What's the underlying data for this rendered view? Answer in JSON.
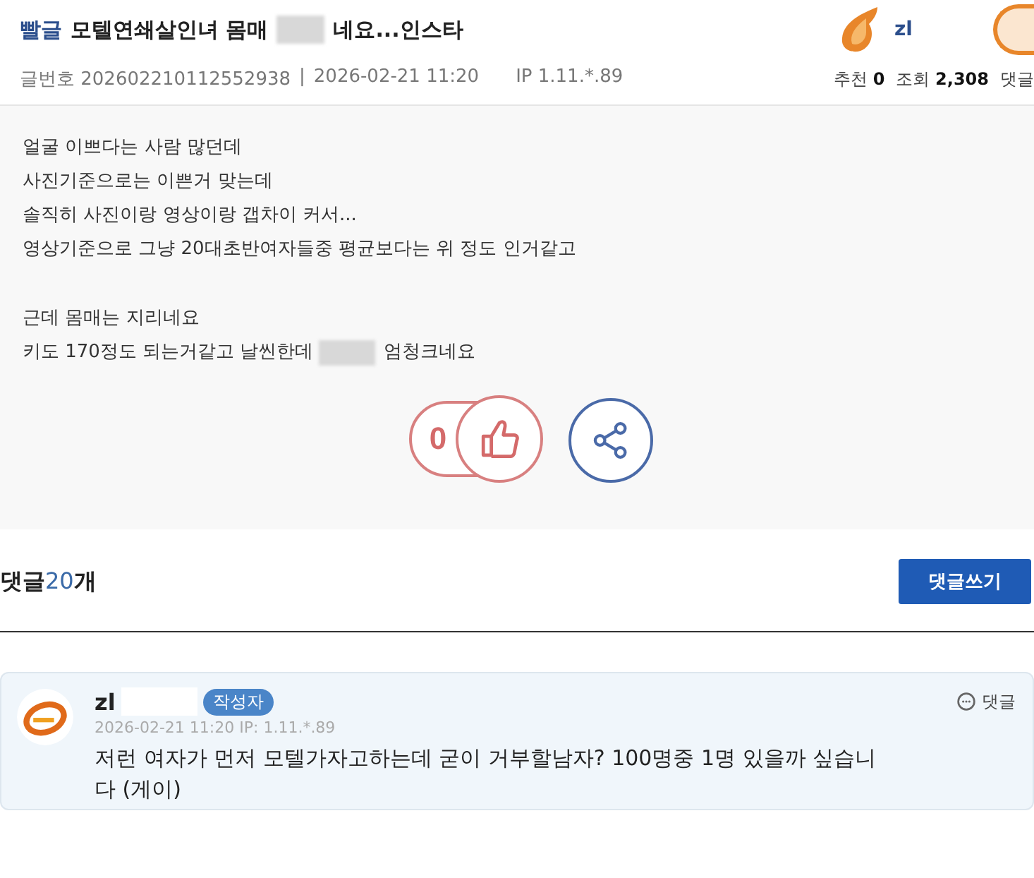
{
  "post": {
    "category": "빨글",
    "title_before": "모텔연쇄살인녀 몸매",
    "title_after": "네요...인스타",
    "author": "zl",
    "meta": {
      "number_label": "글번호",
      "number": "202602210112552938",
      "separator": "|",
      "date": "2026-02-21 11:20",
      "ip": "IP 1.11.*.89",
      "recommend_label": "추천",
      "recommend": "0",
      "views_label": "조회",
      "views": "2,308",
      "comments_label": "댓글"
    },
    "body": [
      [
        "얼굴 이쁘다는 사람 많던데",
        "사진기준으로는 이쁜거 맞는데",
        "솔직히 사진이랑 영상이랑 갭차이 커서...",
        "영상기준으로 그냥 20대초반여자들중 평균보다는 위 정도 인거같고"
      ],
      [
        "근데 몸매는 지리네요",
        {
          "text": "키도 170정도 되는거같고 날씬한데",
          "after_redaction": "엄청크네요"
        }
      ]
    ],
    "like_count": "0"
  },
  "comments_header": {
    "label": "댓글",
    "count": "20",
    "unit": "개",
    "write_button": "댓글쓰기"
  },
  "comments": [
    {
      "author": "zl",
      "badge": "작성자",
      "meta": "2026-02-21 11:20 IP: 1.11.*.89",
      "reply": "댓글",
      "text": "저런 여자가 먼저 모텔가자고하는데 굳이 거부할남자? 100명중 1명 있을까 싶습니다 (게이)"
    }
  ]
}
